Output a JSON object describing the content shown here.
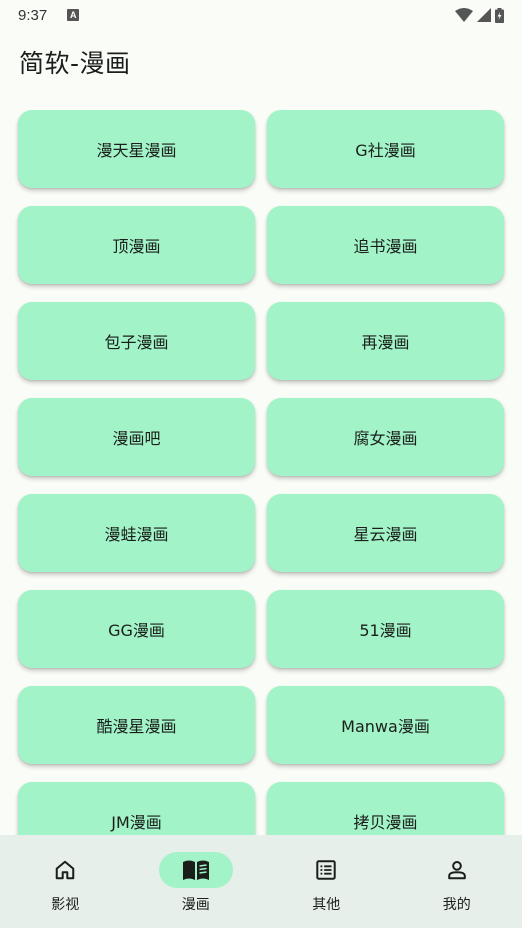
{
  "status_bar": {
    "time": "9:37",
    "notification_glyph": "A"
  },
  "app": {
    "title": "简软-漫画"
  },
  "sources": [
    {
      "label": "漫天星漫画"
    },
    {
      "label": "G社漫画"
    },
    {
      "label": "顶漫画"
    },
    {
      "label": "追书漫画"
    },
    {
      "label": "包子漫画"
    },
    {
      "label": "再漫画"
    },
    {
      "label": "漫画吧"
    },
    {
      "label": "腐女漫画"
    },
    {
      "label": "漫蛙漫画"
    },
    {
      "label": "星云漫画"
    },
    {
      "label": "GG漫画"
    },
    {
      "label": "51漫画"
    },
    {
      "label": "酷漫星漫画"
    },
    {
      "label": "Manwa漫画"
    },
    {
      "label": "JM漫画"
    },
    {
      "label": "拷贝漫画"
    }
  ],
  "bottom_nav": {
    "items": [
      {
        "label": "影视",
        "icon": "home-icon",
        "active": false
      },
      {
        "label": "漫画",
        "icon": "book-icon",
        "active": true
      },
      {
        "label": "其他",
        "icon": "list-icon",
        "active": false
      },
      {
        "label": "我的",
        "icon": "person-icon",
        "active": false
      }
    ]
  },
  "colors": {
    "tile": "#a2f3c7",
    "background": "#fafcf7",
    "nav_background": "#e6efe9",
    "active_pill": "#a2f3c7"
  }
}
